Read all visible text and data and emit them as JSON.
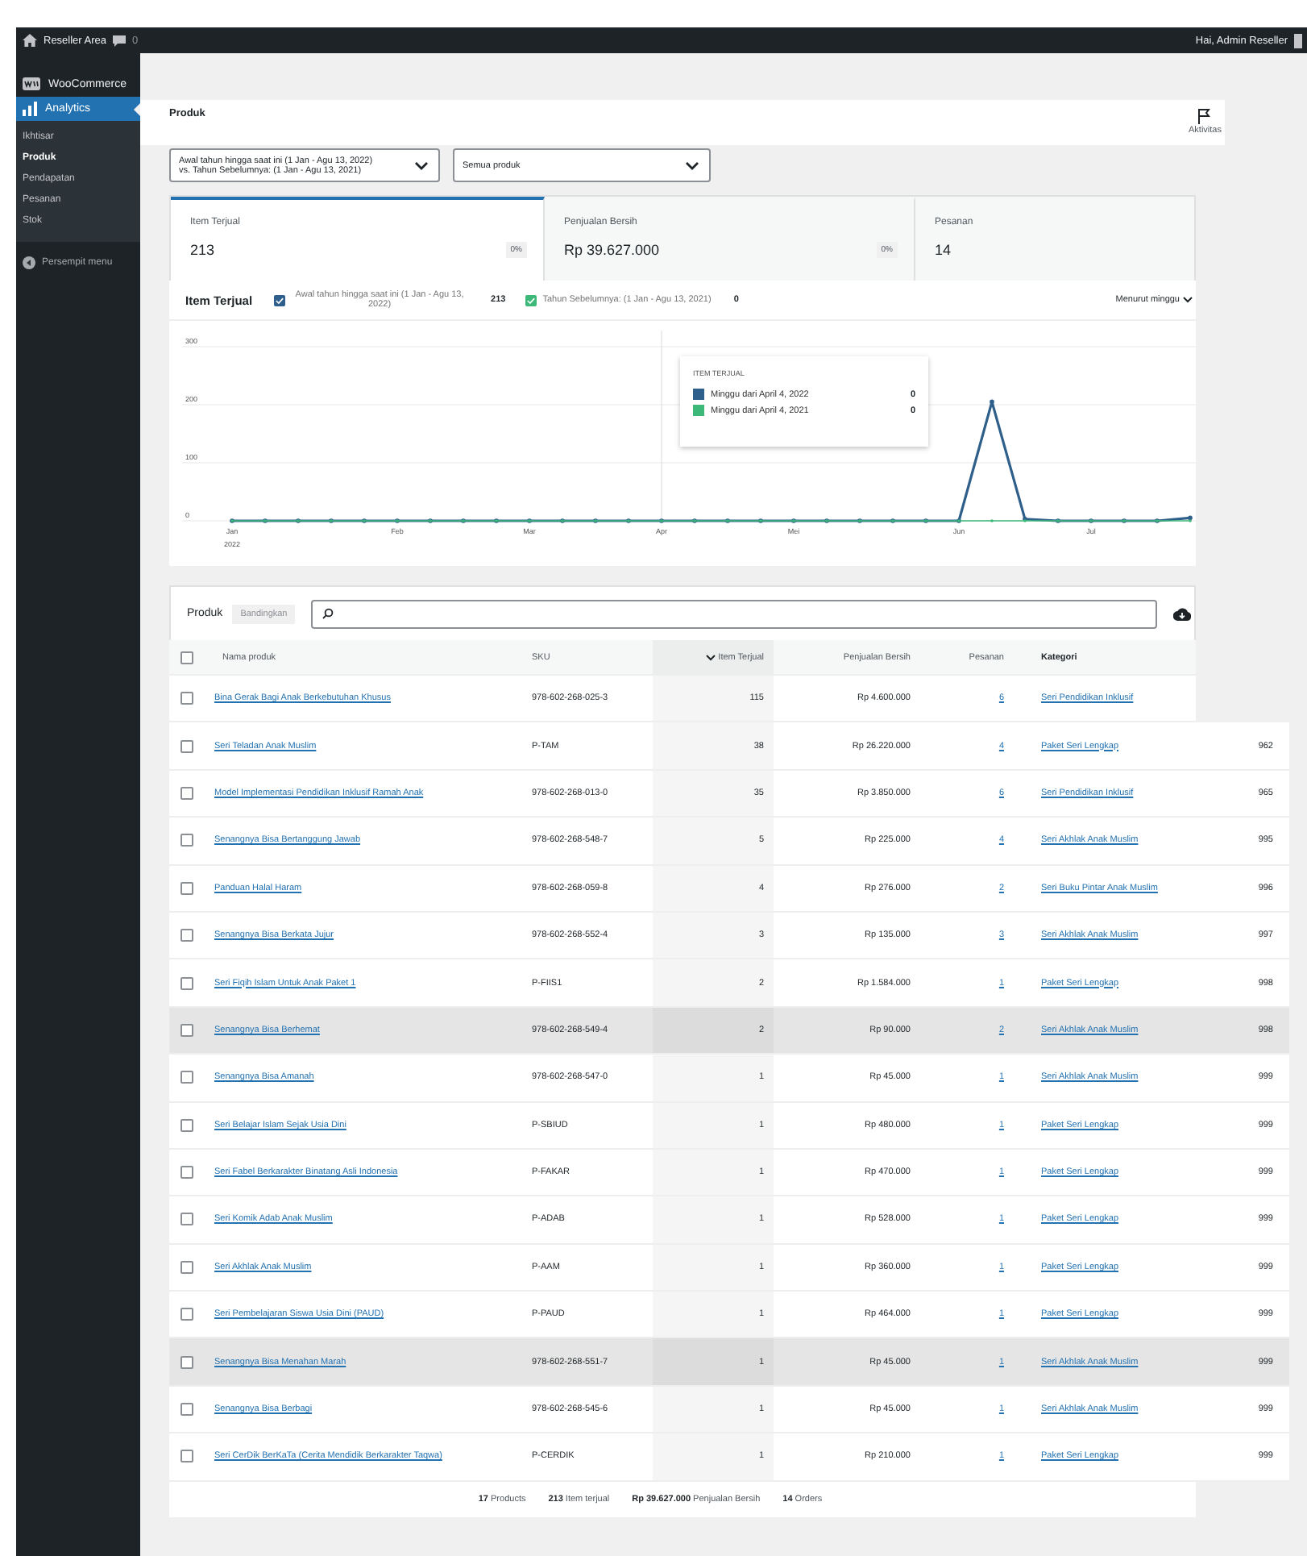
{
  "admin_bar": {
    "site": "Reseller Area",
    "comments": "0",
    "greeting": "Hai, Admin Reseller"
  },
  "sidebar": {
    "items": [
      {
        "label": "WooCommerce",
        "selected": false
      },
      {
        "label": "Analytics",
        "selected": true,
        "children": [
          {
            "label": "Ikhtisar",
            "selected": false
          },
          {
            "label": "Produk",
            "selected": true
          },
          {
            "label": "Pendapatan",
            "selected": false
          },
          {
            "label": "Pesanan",
            "selected": false
          },
          {
            "label": "Stok",
            "selected": false
          }
        ]
      }
    ],
    "collapse": "Persempit menu"
  },
  "header": {
    "title": "Produk",
    "activity": "Aktivitas"
  },
  "filters": [
    {
      "lines": [
        "Awal tahun hingga saat ini (1 Jan - Agu 13, 2022)",
        "vs. Tahun Sebelumnya: (1 Jan - Agu 13, 2021)"
      ]
    },
    {
      "lines": [
        "Semua produk"
      ]
    }
  ],
  "summary": [
    {
      "label": "Item Terjual",
      "value": "213",
      "delta": "0%",
      "selected": true
    },
    {
      "label": "Penjualan Bersih",
      "value": "Rp 39.627.000",
      "delta": "0%",
      "selected": false
    },
    {
      "label": "Pesanan",
      "value": "14",
      "selected": false
    }
  ],
  "chart": {
    "title": "Item Terjual",
    "legend": [
      {
        "total": "213",
        "checked": true
      },
      {
        "total": "0",
        "checked": true
      }
    ],
    "interval": "Menurut minggu",
    "tooltip": {
      "title": "ITEM TERJUAL",
      "rows": [
        {
          "label": "Minggu dari April 4, 2022",
          "value": "0",
          "color": "#2d5f8a"
        },
        {
          "label": "Minggu dari April 4, 2021",
          "value": "0",
          "color": "#3cb878"
        }
      ]
    },
    "chart_data": {
      "type": "line",
      "categories": [
        "Jan 2022",
        null,
        null,
        null,
        null,
        "Feb",
        null,
        null,
        null,
        "Mar",
        null,
        null,
        null,
        "Apr",
        null,
        null,
        null,
        "Mei",
        null,
        null,
        null,
        null,
        "Jun",
        null,
        null,
        null,
        "Jul",
        null,
        null,
        null
      ],
      "series": [
        {
          "name": "Awal tahun hingga saat ini (1 Jan - Agu 13, 2022)",
          "color": "#2d5f8a",
          "values": [
            0,
            0,
            0,
            0,
            0,
            0,
            0,
            0,
            0,
            0,
            0,
            0,
            0,
            0,
            0,
            0,
            0,
            0,
            0,
            0,
            0,
            0,
            0,
            205,
            3,
            0,
            0,
            0,
            0,
            5
          ]
        },
        {
          "name": "Tahun Sebelumnya: (1 Jan - Agu 13, 2021)",
          "color": "#3cb878",
          "values": [
            0,
            0,
            0,
            0,
            0,
            0,
            0,
            0,
            0,
            0,
            0,
            0,
            0,
            0,
            0,
            0,
            0,
            0,
            0,
            0,
            0,
            0,
            0,
            0,
            0,
            0,
            0,
            0,
            0,
            0
          ]
        }
      ],
      "grid": true,
      "ylim": [
        0,
        400
      ],
      "yticks": [
        0,
        100,
        200,
        300
      ]
    }
  },
  "table": {
    "title": "Produk",
    "compare": "Bandingkan",
    "select_all": {
      "checked": false
    },
    "columns": [
      {
        "label": "Nama produk",
        "sorted": false
      },
      {
        "label": "SKU",
        "sorted": false
      },
      {
        "label": "Item Terjual",
        "sorted": true
      },
      {
        "label": "Penjualan Bersih",
        "sorted": false
      },
      {
        "label": "Pesanan",
        "sorted": false
      },
      {
        "label": "Kategori",
        "sorted": false
      }
    ],
    "rows": [
      {
        "name": "Bina Gerak Bagi Anak Berkebutuhan Khusus",
        "sku": "978-602-268-025-3",
        "items": "115",
        "sales": "Rp 4.600.000",
        "orders": "6",
        "category": "Seri Pendidikan Inklusif",
        "highlighted": false
      },
      {
        "name": "Seri Teladan Anak Muslim",
        "sku": "P-TAM",
        "items": "38",
        "sales": "Rp 26.220.000",
        "orders": "4",
        "category": "Paket Seri Lengkap",
        "column_7": "962",
        "highlighted": false
      },
      {
        "name": "Model Implementasi Pendidikan Inklusif Ramah Anak",
        "sku": "978-602-268-013-0",
        "items": "35",
        "sales": "Rp 3.850.000",
        "orders": "6",
        "category": "Seri Pendidikan Inklusif",
        "column_7": "965",
        "highlighted": false
      },
      {
        "name": "Senangnya Bisa Bertanggung Jawab",
        "sku": "978-602-268-548-7",
        "items": "5",
        "sales": "Rp 225.000",
        "orders": "4",
        "category": "Seri Akhlak Anak Muslim",
        "column_7": "995",
        "highlighted": false
      },
      {
        "name": "Panduan Halal Haram",
        "sku": "978-602-268-059-8",
        "items": "4",
        "sales": "Rp 276.000",
        "orders": "2",
        "category": "Seri Buku Pintar Anak Muslim",
        "column_7": "996",
        "highlighted": false
      },
      {
        "name": "Senangnya Bisa Berkata Jujur",
        "sku": "978-602-268-552-4",
        "items": "3",
        "sales": "Rp 135.000",
        "orders": "3",
        "category": "Seri Akhlak Anak Muslim",
        "column_7": "997",
        "highlighted": false
      },
      {
        "name": "Seri Fiqih Islam Untuk Anak Paket 1",
        "sku": "P-FIIS1",
        "items": "2",
        "sales": "Rp 1.584.000",
        "orders": "1",
        "category": "Paket Seri Lengkap",
        "column_7": "998",
        "highlighted": false
      },
      {
        "name": "Senangnya Bisa Berhemat",
        "sku": "978-602-268-549-4",
        "items": "2",
        "sales": "Rp 90.000",
        "orders": "2",
        "category": "Seri Akhlak Anak Muslim",
        "column_7": "998",
        "highlighted": true
      },
      {
        "name": "Senangnya Bisa Amanah",
        "sku": "978-602-268-547-0",
        "items": "1",
        "sales": "Rp 45.000",
        "orders": "1",
        "category": "Seri Akhlak Anak Muslim",
        "column_7": "999",
        "highlighted": false
      },
      {
        "name": "Seri Belajar Islam Sejak Usia Dini",
        "sku": "P-SBIUD",
        "items": "1",
        "sales": "Rp 480.000",
        "orders": "1",
        "category": "Paket Seri Lengkap",
        "column_7": "999",
        "highlighted": false
      },
      {
        "name": "Seri Fabel Berkarakter Binatang Asli Indonesia",
        "sku": "P-FAKAR",
        "items": "1",
        "sales": "Rp 470.000",
        "orders": "1",
        "category": "Paket Seri Lengkap",
        "column_7": "999",
        "highlighted": false
      },
      {
        "name": "Seri Komik Adab Anak Muslim",
        "sku": "P-ADAB",
        "items": "1",
        "sales": "Rp 528.000",
        "orders": "1",
        "category": "Paket Seri Lengkap",
        "column_7": "999",
        "highlighted": false
      },
      {
        "name": "Seri Akhlak Anak Muslim",
        "sku": "P-AAM",
        "items": "1",
        "sales": "Rp 360.000",
        "orders": "1",
        "category": "Paket Seri Lengkap",
        "column_7": "999",
        "highlighted": false
      },
      {
        "name": "Seri Pembelajaran Siswa Usia Dini (PAUD)",
        "sku": "P-PAUD",
        "items": "1",
        "sales": "Rp 464.000",
        "orders": "1",
        "category": "Paket Seri Lengkap",
        "column_7": "999",
        "highlighted": false
      },
      {
        "name": "Senangnya Bisa Menahan Marah",
        "sku": "978-602-268-551-7",
        "items": "1",
        "sales": "Rp 45.000",
        "orders": "1",
        "category": "Seri Akhlak Anak Muslim",
        "column_7": "999",
        "highlighted": true
      },
      {
        "name": "Senangnya Bisa Berbagi",
        "sku": "978-602-268-545-6",
        "items": "1",
        "sales": "Rp 45.000",
        "orders": "1",
        "category": "Seri Akhlak Anak Muslim",
        "column_7": "999",
        "highlighted": false
      },
      {
        "name": "Seri CerDik BerKaTa (Cerita Mendidik Berkarakter Taqwa)",
        "sku": "P-CERDIK",
        "items": "1",
        "sales": "Rp 210.000",
        "orders": "1",
        "category": "Paket Seri Lengkap",
        "column_7": "999",
        "highlighted": false
      }
    ],
    "totals": [
      {
        "value": "17",
        "label": "Products"
      },
      {
        "value": "213",
        "label": "Item terjual"
      },
      {
        "value": "Rp 39.627.000",
        "label": "Penjualan Bersih"
      },
      {
        "value": "14",
        "label": "Orders"
      }
    ]
  }
}
